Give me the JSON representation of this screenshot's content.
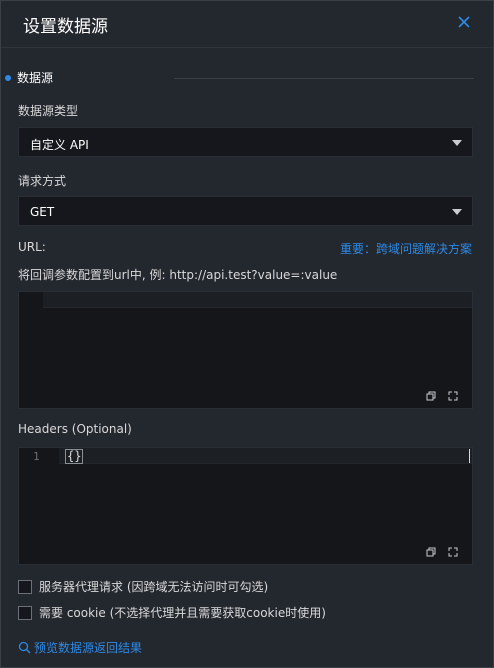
{
  "header": {
    "title": "设置数据源"
  },
  "section": {
    "label": "数据源"
  },
  "datasource_type": {
    "label": "数据源类型",
    "value": "自定义 API"
  },
  "method": {
    "label": "请求方式",
    "value": "GET"
  },
  "url": {
    "label": "URL:",
    "help_link": "重要：跨域问题解决方案",
    "hint": "将回调参数配置到url中, 例: http://api.test?value=:value"
  },
  "headers": {
    "label": "Headers (Optional)",
    "line_number": "1",
    "code": "{}"
  },
  "options": [
    {
      "label": "服务器代理请求 (因跨域无法访问时可勾选)",
      "checked": false
    },
    {
      "label": "需要 cookie (不选择代理并且需要获取cookie时使用)",
      "checked": false
    }
  ],
  "preview": {
    "label": "预览数据源返回结果"
  },
  "icons": {
    "close": "close-icon",
    "copy": "copy-icon",
    "fullscreen": "fullscreen-icon",
    "search": "search-icon"
  },
  "colors": {
    "accent": "#2e8ae6",
    "background": "#23272e",
    "input": "#15171c"
  }
}
